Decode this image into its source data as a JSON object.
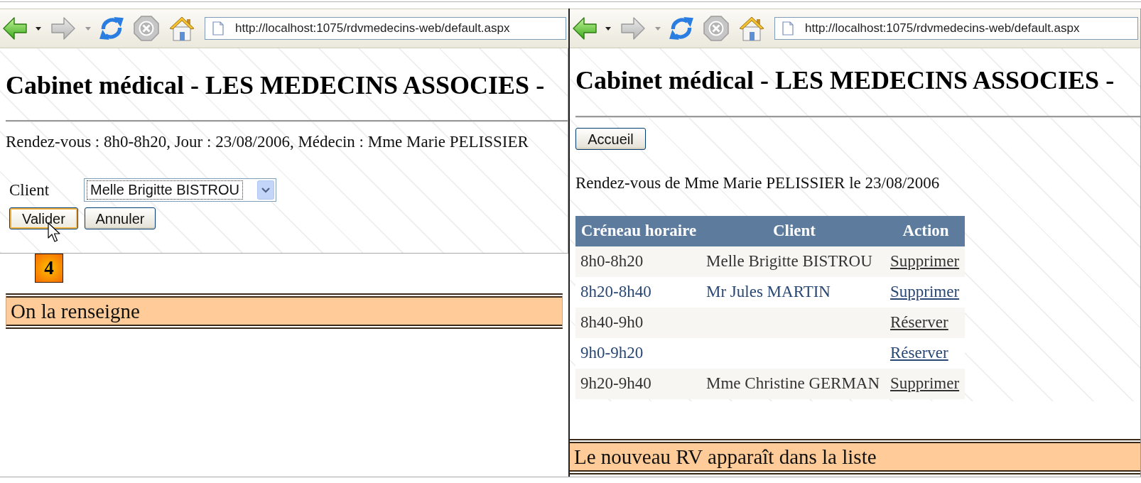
{
  "screens": [
    {
      "kind": "form",
      "browser": {
        "url": "http://localhost:1075/rdvmedecins-web/default.aspx"
      },
      "title": "Cabinet médical - LES MEDECINS ASSOCIES -",
      "summary": "Rendez-vous : 8h0-8h20, Jour : 23/08/2006, Médecin : Mme Marie PELISSIER",
      "client": {
        "label": "Client",
        "value": "Melle Brigitte BISTROU"
      },
      "buttons": [
        {
          "label": "Valider",
          "hovered": true
        },
        {
          "label": "Annuler",
          "hovered": false
        }
      ],
      "step_badge": "4",
      "caption": "On la renseigne"
    },
    {
      "kind": "agenda",
      "browser": {
        "url": "http://localhost:1075/rdvmedecins-web/default.aspx"
      },
      "title": "Cabinet médical - LES MEDECINS ASSOCIES -",
      "buttons": [
        {
          "label": "Accueil",
          "hovered": false
        }
      ],
      "heading": "Rendez-vous de Mme Marie PELISSIER le 23/08/2006",
      "table": {
        "columns": [
          "Créneau horaire",
          "Client",
          "Action"
        ],
        "rows": [
          {
            "slot": "8h0-8h20",
            "client": "Melle Brigitte BISTROU",
            "action": "Supprimer"
          },
          {
            "slot": "8h20-8h40",
            "client": "Mr Jules MARTIN",
            "action": "Supprimer"
          },
          {
            "slot": "8h40-9h0",
            "action": "Réserver"
          },
          {
            "slot": "9h0-9h20",
            "action": "Réserver"
          },
          {
            "slot": "9h20-9h40",
            "client": "Mme Christine GERMAN",
            "action": "Supprimer"
          }
        ]
      },
      "caption": "Le nouveau RV apparaît dans la liste"
    }
  ]
}
